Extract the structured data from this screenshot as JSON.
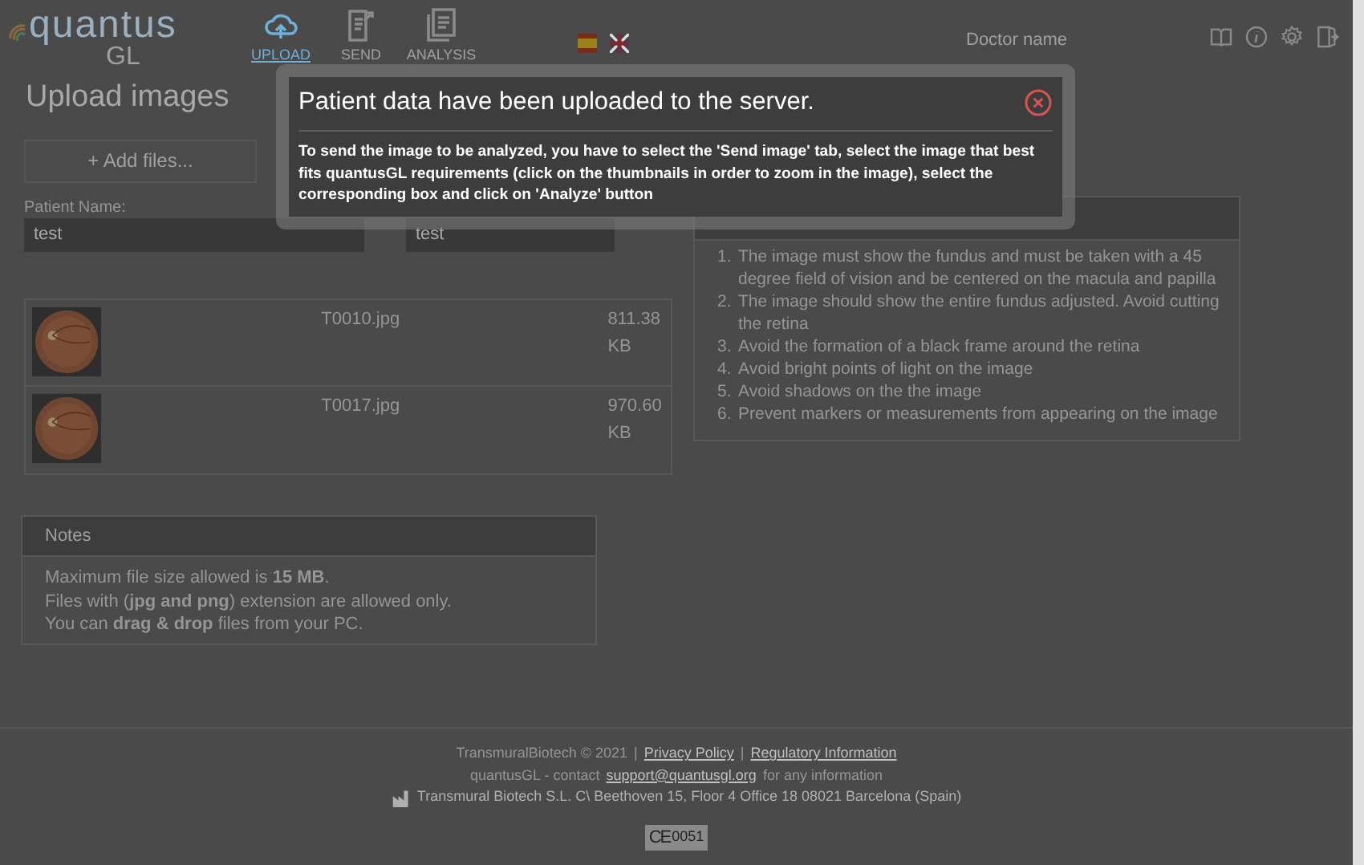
{
  "header": {
    "logo": {
      "word": "quantus",
      "sub": "GL"
    },
    "tabs": [
      {
        "label": "UPLOAD",
        "selected": true,
        "kind": "cloud"
      },
      {
        "label": "SEND",
        "selected": false,
        "kind": "doc-send"
      },
      {
        "label": "ANALYSIS",
        "selected": false,
        "kind": "docs"
      }
    ],
    "languages": [
      {
        "kind": "es"
      },
      {
        "kind": "en"
      }
    ],
    "user": "Doctor name",
    "tools": [
      {
        "kind": "book"
      },
      {
        "kind": "info"
      },
      {
        "kind": "settings"
      },
      {
        "kind": "logout"
      }
    ]
  },
  "page_title": "Upload images",
  "add_button": "+ Add files...",
  "fields": [
    {
      "label": "Patient Name:",
      "value": "test"
    },
    {
      "value": "test"
    }
  ],
  "files": [
    {
      "name": "T0010.jpg",
      "size": "811.38 KB"
    },
    {
      "name": "T0017.jpg",
      "size": "970.60 KB"
    }
  ],
  "requirements": [
    {
      "number": "1.",
      "text": "The image must show the fundus and must be taken with a 45 degree field of vision and be centered on the macula and papilla"
    },
    {
      "number": "2.",
      "text": "The image should show the entire fundus adjusted. Avoid cutting the retina"
    },
    {
      "number": "3.",
      "text": "Avoid the formation of a black frame around the retina"
    },
    {
      "number": "4.",
      "text": "Avoid bright points of light on the image"
    },
    {
      "number": "5.",
      "text": "Avoid shadows on the the image"
    },
    {
      "number": "6.",
      "text": "Prevent markers or measurements from appearing on the image"
    }
  ],
  "notes": {
    "title": "Notes",
    "lines": [
      "Maximum file size allowed is **15 MB**.",
      "Files with (**jpg and png**) extension are allowed only.",
      "You can **drag & drop** files from your PC."
    ]
  },
  "footer": {
    "copyright": "TransmuralBiotech © 2021",
    "links": [
      {
        "separator": "|",
        "label": "Privacy Policy"
      },
      {
        "separator": "|",
        "label": "Regulatory Information"
      }
    ],
    "contact_before": "quantusGL - contact",
    "email": "support@quantusgl.org",
    "contact_after": "for any information",
    "address": "Transmural Biotech S.L. C\\ Beethoven 15, Floor 4 Office 18 08021 Barcelona (Spain)",
    "ce": "CE",
    "ce_number": "0051"
  },
  "modal": {
    "title": "Patient data have been uploaded to the server.",
    "body": "To send the image to be analyzed, you have to select the 'Send image' tab, select the image that best fits quantusGL requirements (click on the thumbnails in order to zoom in the image), select the corresponding box and click on 'Analyze' button"
  }
}
